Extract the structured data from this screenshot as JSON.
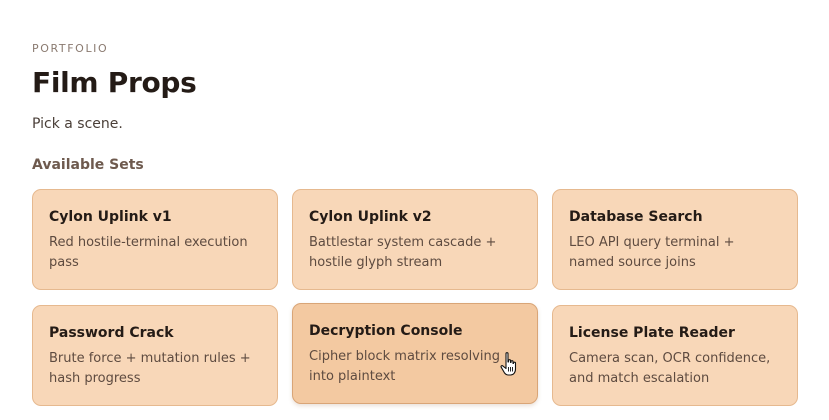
{
  "header": {
    "eyebrow": "PORTFOLIO",
    "title": "Film Props",
    "subtitle": "Pick a scene."
  },
  "section": {
    "heading": "Available Sets"
  },
  "sets": [
    {
      "title": "Cylon Uplink v1",
      "description": "Red hostile-terminal execution pass"
    },
    {
      "title": "Cylon Uplink v2",
      "description": "Battlestar system cascade + hostile glyph stream"
    },
    {
      "title": "Database Search",
      "description": "LEO API query terminal + named source joins"
    },
    {
      "title": "Password Crack",
      "description": "Brute force + mutation rules + hash progress"
    },
    {
      "title": "Decryption Console",
      "description": "Cipher block matrix resolving into plaintext"
    },
    {
      "title": "License Plate Reader",
      "description": "Camera scan, OCR confidence, and match escalation"
    }
  ],
  "state": {
    "hovered_set": "Decryption Console",
    "cursor_icon": "hand-pointer-icon"
  },
  "colors": {
    "card_background": "#f8d7b8",
    "card_hover_background": "#f3c9a1",
    "card_border": "#e6b98f"
  }
}
